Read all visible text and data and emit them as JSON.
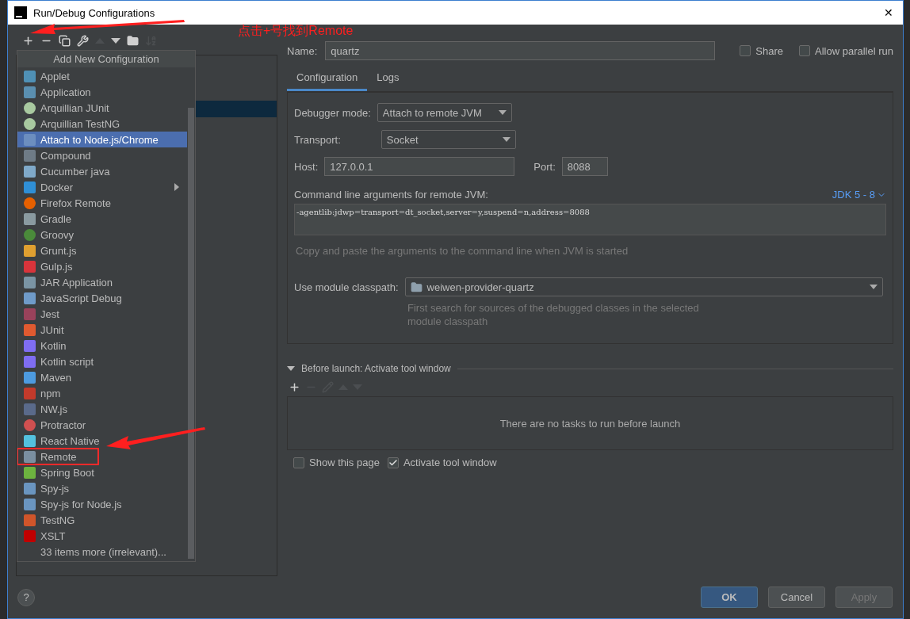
{
  "window": {
    "title": "Run/Debug Configurations",
    "close": "✕"
  },
  "toolbar": [
    {
      "kind": "add",
      "disabled": false
    },
    {
      "kind": "remove",
      "disabled": false
    },
    {
      "kind": "copy",
      "disabled": false
    },
    {
      "kind": "edit",
      "disabled": false
    },
    {
      "kind": "up",
      "disabled": true
    },
    {
      "kind": "down",
      "disabled": false
    },
    {
      "kind": "folder",
      "disabled": false
    },
    {
      "kind": "sort",
      "disabled": true
    }
  ],
  "annotation": {
    "text": "点击+号找到Remote"
  },
  "popup": {
    "title": "Add New Configuration",
    "items": [
      {
        "label": "Applet",
        "selected": false,
        "submenu": false,
        "annotated": false
      },
      {
        "label": "Application",
        "selected": false,
        "submenu": false,
        "annotated": false
      },
      {
        "label": "Arquillian JUnit",
        "selected": false,
        "submenu": false,
        "annotated": false
      },
      {
        "label": "Arquillian TestNG",
        "selected": false,
        "submenu": false,
        "annotated": false
      },
      {
        "label": "Attach to Node.js/Chrome",
        "selected": true,
        "submenu": false,
        "annotated": false
      },
      {
        "label": "Compound",
        "selected": false,
        "submenu": false,
        "annotated": false
      },
      {
        "label": "Cucumber java",
        "selected": false,
        "submenu": false,
        "annotated": false
      },
      {
        "label": "Docker",
        "selected": false,
        "submenu": true,
        "annotated": false
      },
      {
        "label": "Firefox Remote",
        "selected": false,
        "submenu": false,
        "annotated": false
      },
      {
        "label": "Gradle",
        "selected": false,
        "submenu": false,
        "annotated": false
      },
      {
        "label": "Groovy",
        "selected": false,
        "submenu": false,
        "annotated": false
      },
      {
        "label": "Grunt.js",
        "selected": false,
        "submenu": false,
        "annotated": false
      },
      {
        "label": "Gulp.js",
        "selected": false,
        "submenu": false,
        "annotated": false
      },
      {
        "label": "JAR Application",
        "selected": false,
        "submenu": false,
        "annotated": false
      },
      {
        "label": "JavaScript Debug",
        "selected": false,
        "submenu": false,
        "annotated": false
      },
      {
        "label": "Jest",
        "selected": false,
        "submenu": false,
        "annotated": false
      },
      {
        "label": "JUnit",
        "selected": false,
        "submenu": false,
        "annotated": false
      },
      {
        "label": "Kotlin",
        "selected": false,
        "submenu": false,
        "annotated": false
      },
      {
        "label": "Kotlin script",
        "selected": false,
        "submenu": false,
        "annotated": false
      },
      {
        "label": "Maven",
        "selected": false,
        "submenu": false,
        "annotated": false
      },
      {
        "label": "npm",
        "selected": false,
        "submenu": false,
        "annotated": false
      },
      {
        "label": "NW.js",
        "selected": false,
        "submenu": false,
        "annotated": false
      },
      {
        "label": "Protractor",
        "selected": false,
        "submenu": false,
        "annotated": false
      },
      {
        "label": "React Native",
        "selected": false,
        "submenu": false,
        "annotated": false
      },
      {
        "label": "Remote",
        "selected": false,
        "submenu": false,
        "annotated": true
      },
      {
        "label": "Spring Boot",
        "selected": false,
        "submenu": false,
        "annotated": false
      },
      {
        "label": "Spy-js",
        "selected": false,
        "submenu": false,
        "annotated": false
      },
      {
        "label": "Spy-js for Node.js",
        "selected": false,
        "submenu": false,
        "annotated": false
      },
      {
        "label": "TestNG",
        "selected": false,
        "submenu": false,
        "annotated": false
      },
      {
        "label": "XSLT",
        "selected": false,
        "submenu": false,
        "annotated": false
      },
      {
        "label": "33 items more (irrelevant)...",
        "selected": false,
        "submenu": false,
        "annotated": false
      }
    ]
  },
  "name_field": {
    "label": "Name:",
    "value": "quartz"
  },
  "options": [
    {
      "label": "Share",
      "checked": false
    },
    {
      "label": "Allow parallel run",
      "checked": false
    }
  ],
  "tabs": [
    {
      "label": "Configuration",
      "selected": true
    },
    {
      "label": "Logs",
      "selected": false
    }
  ],
  "configuration": {
    "debugger_mode": {
      "label": "Debugger mode:",
      "value": "Attach to remote JVM"
    },
    "transport": {
      "label": "Transport:",
      "value": "Socket"
    },
    "host": {
      "label": "Host:",
      "value": "127.0.0.1"
    },
    "port": {
      "label": "Port:",
      "value": "8088"
    },
    "args": {
      "label": "Command line arguments for remote JVM:",
      "jdk": "JDK 5 - 8",
      "value": "-agentlib:jdwp=transport=dt_socket,server=y,suspend=n,address=8088",
      "hint": "Copy and paste the arguments to the command line when JVM is started"
    },
    "module": {
      "label": "Use module classpath:",
      "value": "weiwen-provider-quartz",
      "hint": "First search for sources of the debugged classes in the selected module classpath"
    }
  },
  "before_launch": {
    "title": "Before launch: Activate tool window",
    "expanded": true,
    "toolbar": [
      {
        "kind": "add",
        "disabled": false
      },
      {
        "kind": "remove",
        "disabled": true
      },
      {
        "kind": "edit",
        "disabled": true
      },
      {
        "kind": "up",
        "disabled": true
      },
      {
        "kind": "down",
        "disabled": true
      }
    ],
    "empty_text": "There are no tasks to run before launch"
  },
  "launch_options": [
    {
      "label": "Show this page",
      "checked": false
    },
    {
      "label": "Activate tool window",
      "checked": true
    }
  ],
  "help": "?",
  "buttons": [
    {
      "label": "OK",
      "kind": "primary",
      "disabled": false
    },
    {
      "label": "Cancel",
      "kind": "normal",
      "disabled": false
    },
    {
      "label": "Apply",
      "kind": "normal",
      "disabled": true
    }
  ]
}
